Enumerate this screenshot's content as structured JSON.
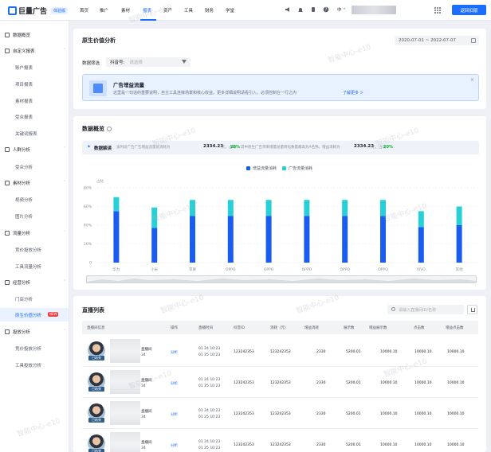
{
  "brand": {
    "name": "巨量广告",
    "badge": "体验版"
  },
  "nav": {
    "items": [
      "首页",
      "推广",
      "素材",
      "报表",
      "资产",
      "工具",
      "财务",
      "学堂"
    ],
    "active": "报表"
  },
  "top": {
    "lang": "中",
    "back_label": "返回旧版"
  },
  "sidebar": {
    "groups": [
      {
        "label": "数据概览",
        "items": []
      },
      {
        "label": "自定义报表",
        "items": [
          "账户报表",
          "项目报表",
          "素材报表",
          "受众报表",
          "关键词报表"
        ]
      },
      {
        "label": "人群分析",
        "items": [
          "受众分析"
        ]
      },
      {
        "label": "素材分析",
        "items": [
          "视频分析",
          "图片分析"
        ]
      },
      {
        "label": "流量分析",
        "items": [
          "竞价投放分析",
          "工具流量分析"
        ]
      },
      {
        "label": "经营分析",
        "items": [
          "门店分析",
          "原生价值分析"
        ]
      },
      {
        "label": "投放分析",
        "items": [
          "竞价投放分析",
          "工具投放分析"
        ]
      }
    ],
    "active_item": "原生价值分析",
    "new_badge": "NEW"
  },
  "page": {
    "title": "原生价值分析",
    "date_range": "2020-07-01 ~ 2022-07-07",
    "filter_label": "数据筛选",
    "filter_select_label": "抖音号:",
    "filter_select_placeholder": "请选择"
  },
  "banner": {
    "title": "广告增益流量",
    "desc": "这里是一句话的重要说明，自主工具连接场景和核心收益。更多详细说明请看引入，必须控制在一行之内",
    "link": "了解更多 >",
    "close": "×"
  },
  "overview": {
    "title": "数据概览",
    "summary_title": "数据解读",
    "text1": "该时段广告广告增益流量总消耗为",
    "value1": "2334.23",
    "text2": "元，占比",
    "pct1": "20%",
    "text3": "其中原生广告带来增量总量转化数量最高为A名称，增益消耗为",
    "value2": "2334.23",
    "text4": "元，占比",
    "pct2": "20%"
  },
  "chart_data": {
    "type": "bar",
    "stacked": true,
    "y_unit": "占比",
    "categories": [
      "华为",
      "小米",
      "苹果",
      "OPPO",
      "OPPO",
      "OPPO",
      "OPPO",
      "OPPO",
      "VIVO",
      "其他"
    ],
    "series": [
      {
        "name": "增益流量消耗",
        "color": "#1a5cf0",
        "values": [
          55,
          37,
          50,
          50,
          50,
          50,
          50,
          50,
          38,
          40
        ]
      },
      {
        "name": "广告流量消耗",
        "color": "#26d0d6",
        "values": [
          15,
          22,
          17,
          17,
          17,
          17,
          17,
          17,
          17,
          20
        ]
      }
    ],
    "yticks": [
      "80%",
      "60%",
      "40%",
      "20%",
      "0"
    ],
    "ylim": [
      0,
      80
    ],
    "legend": "top-center"
  },
  "table": {
    "title": "直播列表",
    "search_placeholder": "请输入直播间ID/名称",
    "headers": [
      "直播间信息",
      "操作",
      "直播时间",
      "抖音ID",
      "消耗（元）",
      "增益消耗",
      "展示数",
      "增益展示数",
      "点击数",
      "增益点击数"
    ],
    "rows": [
      {
        "tag": "已结束",
        "name_suffix": "直播间",
        "sub": "34",
        "op": "分析",
        "start": "01 24 10:23",
        "end": "01 25 10:23",
        "douyin_id": "123242353",
        "cost": "123242353",
        "gain_cost": "2330",
        "impr": "5200.01",
        "gain_impr": "10000.10",
        "clicks": "10000.10",
        "gain_clicks": "10000.10"
      },
      {
        "tag": "已结束",
        "name_suffix": "直播间",
        "sub": "34",
        "op": "分析",
        "start": "01 24 10:23",
        "end": "01 25 10:23",
        "douyin_id": "123242353",
        "cost": "123242353",
        "gain_cost": "2330",
        "impr": "5200.01",
        "gain_impr": "10000.10",
        "clicks": "10000.10",
        "gain_clicks": "10000.10"
      },
      {
        "tag": "已结束",
        "name_suffix": "直播间",
        "sub": "34",
        "op": "分析",
        "start": "01 24 10:23",
        "end": "01 25 10:23",
        "douyin_id": "123242353",
        "cost": "123242353",
        "gain_cost": "2330",
        "impr": "5200.01",
        "gain_impr": "10000.10",
        "clicks": "10000.10",
        "gain_clicks": "10000.10"
      },
      {
        "tag": "已结束",
        "name_suffix": "直播间",
        "sub": "34",
        "op": "分析",
        "start": "01 24 10:23",
        "end": "01 25 10:23",
        "douyin_id": "123242353",
        "cost": "123242353",
        "gain_cost": "2330",
        "impr": "5200.01",
        "gain_impr": "10000.10",
        "clicks": "10000.10",
        "gain_clicks": "10000.10"
      }
    ]
  },
  "watermark": "智能中心-e10"
}
